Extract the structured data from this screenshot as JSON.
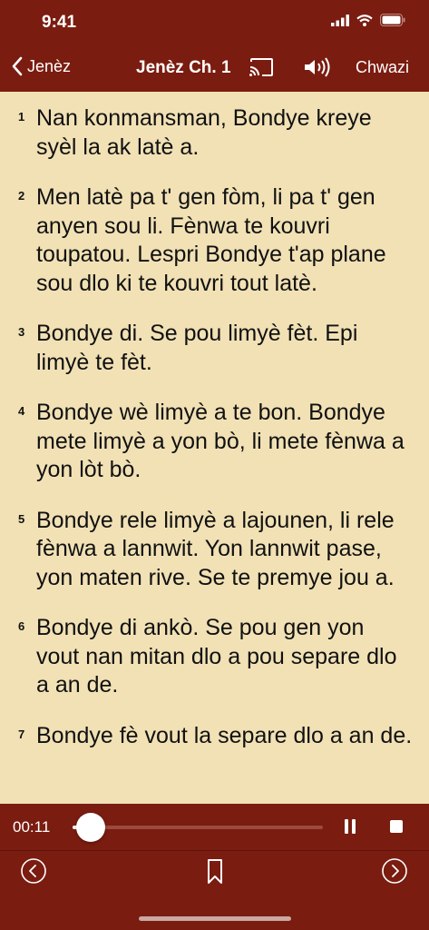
{
  "status_bar": {
    "time": "9:41"
  },
  "nav": {
    "back_label": "Jenèz",
    "title": "Jenèz Ch. 1",
    "choose_label": "Chwazi"
  },
  "verses": [
    {
      "num": "1",
      "text": "Nan konmansman, Bondye kreye syèl la ak latè a."
    },
    {
      "num": "2",
      "text": "Men latè pa t' gen fòm, li pa t' gen anyen sou li. Fènwa te kouvri toupatou. Lespri Bondye t'ap plane sou dlo ki te kouvri tout latè."
    },
    {
      "num": "3",
      "text": "Bondye di. Se pou limyè fèt. Epi limyè te fèt."
    },
    {
      "num": "4",
      "text": "Bondye wè limyè a te bon. Bondye mete limyè a yon bò, li mete fènwa a yon lòt bò."
    },
    {
      "num": "5",
      "text": "Bondye rele limyè a lajounen, li rele fènwa a lannwit. Yon lannwit pase, yon maten rive. Se te premye jou a."
    },
    {
      "num": "6",
      "text": "Bondye di ankò. Se pou gen yon vout nan mitan dlo a pou separe dlo a an de."
    },
    {
      "num": "7",
      "text": "Bondye fè vout la separe dlo a an de."
    }
  ],
  "player": {
    "elapsed": "00:11",
    "progress": 0.05
  },
  "icons": [
    "signal-icon",
    "wifi-icon",
    "battery-icon",
    "chevron-left-icon",
    "cast-icon",
    "speaker-icon",
    "pause-icon",
    "stop-icon",
    "previous-chapter-icon",
    "bookmark-icon",
    "next-chapter-icon"
  ],
  "colors": {
    "bar": "#7A1C10",
    "page": "#F1E1B5",
    "text": "#111111"
  }
}
